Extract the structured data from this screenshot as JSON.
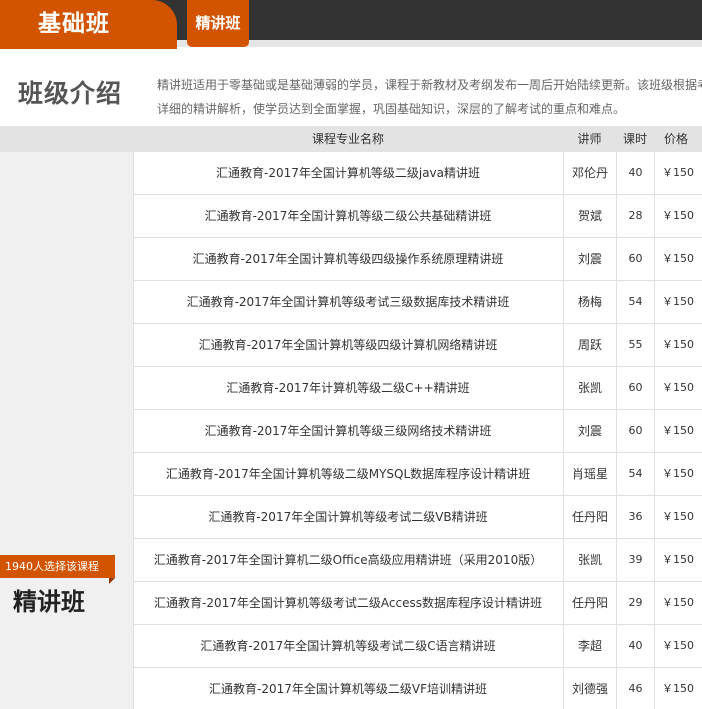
{
  "tabs": {
    "main_label": "基础班",
    "sub_label": "精讲班"
  },
  "intro": {
    "heading": "班级介绍",
    "line1": "精讲班适用于零基础或是基础薄弱的学员，课程于新教材及考纲发布一周后开始陆续更新。该班级根据考",
    "line2": "详细的精讲解析，使学员达到全面掌握，巩固基础知识，深层的了解考试的重点和难点。"
  },
  "table_header": {
    "name": "课程专业名称",
    "teacher": "讲师",
    "hours": "课时",
    "price": "价格"
  },
  "side": {
    "count_badge": "1940人选择该课程",
    "class_name": "精讲班"
  },
  "courses": [
    {
      "name": "汇通教育-2017年全国计算机等级二级java精讲班",
      "teacher": "邓伦丹",
      "hours": "40",
      "price": "￥150"
    },
    {
      "name": "汇通教育-2017年全国计算机等级二级公共基础精讲班",
      "teacher": "贺斌",
      "hours": "28",
      "price": "￥150"
    },
    {
      "name": "汇通教育-2017年全国计算机等级四级操作系统原理精讲班",
      "teacher": "刘震",
      "hours": "60",
      "price": "￥150"
    },
    {
      "name": "汇通教育-2017年全国计算机等级考试三级数据库技术精讲班",
      "teacher": "杨梅",
      "hours": "54",
      "price": "￥150"
    },
    {
      "name": "汇通教育-2017年全国计算机等级四级计算机网络精讲班",
      "teacher": "周跃",
      "hours": "55",
      "price": "￥150"
    },
    {
      "name": "汇通教育-2017年计算机等级二级C++精讲班",
      "teacher": "张凯",
      "hours": "60",
      "price": "￥150"
    },
    {
      "name": "汇通教育-2017年全国计算机等级三级网络技术精讲班",
      "teacher": "刘震",
      "hours": "60",
      "price": "￥150"
    },
    {
      "name": "汇通教育-2017年全国计算机等级二级MYSQL数据库程序设计精讲班",
      "teacher": "肖瑶星",
      "hours": "54",
      "price": "￥150"
    },
    {
      "name": "汇通教育-2017年全国计算机等级考试二级VB精讲班",
      "teacher": "任丹阳",
      "hours": "36",
      "price": "￥150"
    },
    {
      "name": "汇通教育-2017年全国计算机二级Office高级应用精讲班（采用2010版）",
      "teacher": "张凯",
      "hours": "39",
      "price": "￥150"
    },
    {
      "name": "汇通教育-2017年全国计算机等级考试二级Access数据库程序设计精讲班",
      "teacher": "任丹阳",
      "hours": "29",
      "price": "￥150"
    },
    {
      "name": "汇通教育-2017年全国计算机等级考试二级C语言精讲班",
      "teacher": "李超",
      "hours": "40",
      "price": "￥150"
    },
    {
      "name": "汇通教育-2017年全国计算机等级二级VF培训精讲班",
      "teacher": "刘德强",
      "hours": "46",
      "price": "￥150"
    }
  ],
  "colors": {
    "accent": "#d35400",
    "topbar": "#333333",
    "header_bg": "#e3e3e3",
    "side_bg": "#f0f0f0"
  }
}
